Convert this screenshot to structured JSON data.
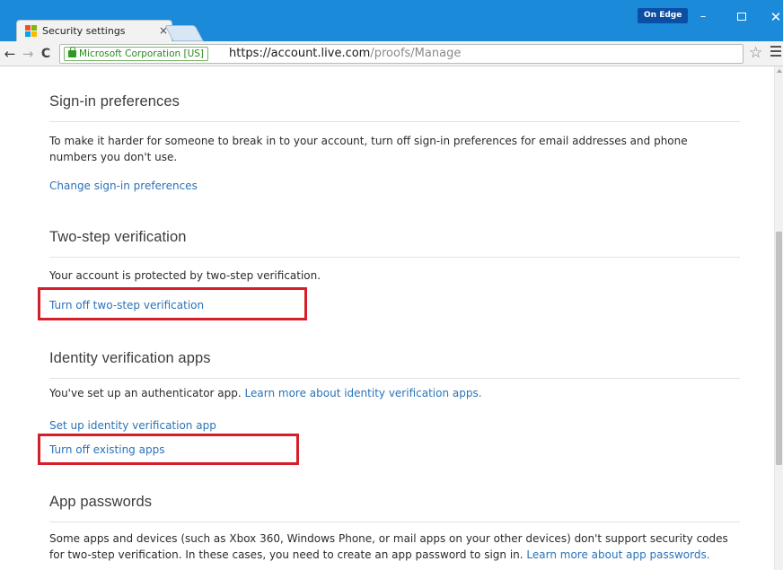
{
  "browser": {
    "tab_title": "Security settings",
    "tab_close": "×",
    "profile_badge": "On Edge",
    "minimize": "–",
    "close": "✕",
    "back": "←",
    "forward": "→",
    "reload": "C",
    "ev_certificate": "Microsoft Corporation [US]",
    "url_scheme": "https://",
    "url_host": "account.live.com",
    "url_path": "/proofs/Manage",
    "bookmark_star": "☆",
    "favicon_colors": [
      "#f25022",
      "#7fba00",
      "#00a4ef",
      "#ffb900"
    ],
    "titlebar_color": "#1a8ad9"
  },
  "sections": {
    "signin": {
      "heading": "Sign-in preferences",
      "description": "To make it harder for someone to break in to your account, turn off sign-in preferences for email addresses and phone numbers you don't use.",
      "link": "Change sign-in preferences"
    },
    "two_step": {
      "heading": "Two-step verification",
      "description": "Your account is protected by two-step verification.",
      "link": "Turn off two-step verification"
    },
    "identity_apps": {
      "heading": "Identity verification apps",
      "description": "You've set up an authenticator app.",
      "description_link": "Learn more about identity verification apps.",
      "link_setup": "Set up identity verification app",
      "link_turn_off": "Turn off existing apps"
    },
    "app_passwords": {
      "heading": "App passwords",
      "description": "Some apps and devices (such as Xbox 360, Windows Phone, or mail apps on your other devices) don't support security codes for two-step verification. In these cases, you need to create an app password to sign in.",
      "description_link": "Learn more about app passwords."
    }
  },
  "colors": {
    "link": "#2a73b8",
    "highlight_box": "#d61e2b"
  }
}
